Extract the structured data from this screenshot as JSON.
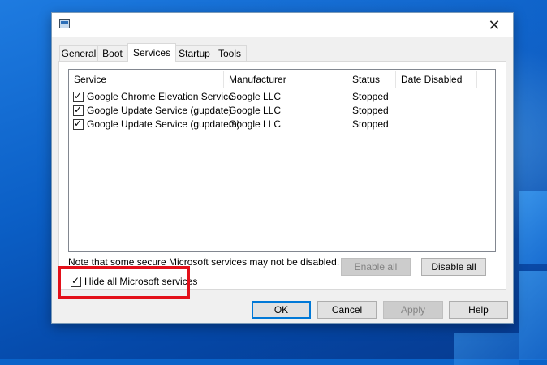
{
  "tabs": [
    {
      "label": "General"
    },
    {
      "label": "Boot"
    },
    {
      "label": "Services"
    },
    {
      "label": "Startup"
    },
    {
      "label": "Tools"
    }
  ],
  "active_tab": "Services",
  "columns": [
    "Service",
    "Manufacturer",
    "Status",
    "Date Disabled"
  ],
  "services": [
    {
      "name": "Google Chrome Elevation Service",
      "manufacturer": "Google LLC",
      "status": "Stopped",
      "date_disabled": "",
      "checked": true
    },
    {
      "name": "Google Update Service (gupdate)",
      "manufacturer": "Google LLC",
      "status": "Stopped",
      "date_disabled": "",
      "checked": true
    },
    {
      "name": "Google Update Service (gupdatem)",
      "manufacturer": "Google LLC",
      "status": "Stopped",
      "date_disabled": "",
      "checked": true
    }
  ],
  "note": "Note that some secure Microsoft services may not be disabled.",
  "enable_all": "Enable all",
  "disable_all": "Disable all",
  "hide_microsoft_label": "Hide all Microsoft services",
  "hide_microsoft_checked": true,
  "buttons": {
    "ok": "OK",
    "cancel": "Cancel",
    "apply": "Apply",
    "help": "Help"
  },
  "close_glyph": "✕",
  "check_glyph": "✓",
  "colors": {
    "highlight": "#e3101a",
    "accent": "#0078d7"
  }
}
